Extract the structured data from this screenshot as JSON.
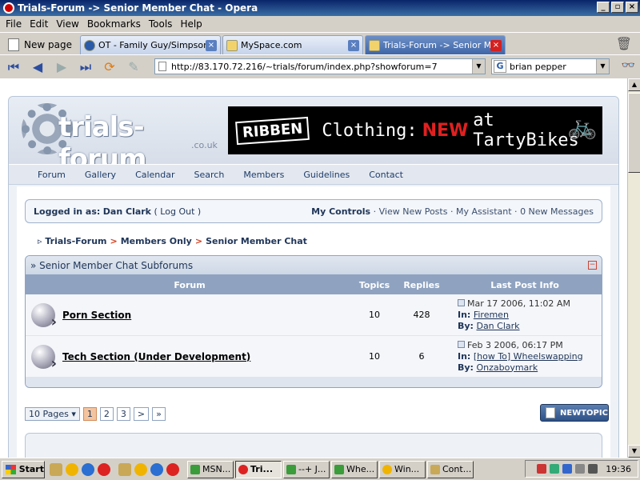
{
  "window": {
    "title": "Trials-Forum -> Senior Member Chat - Opera"
  },
  "menu": [
    "File",
    "Edit",
    "View",
    "Bookmarks",
    "Tools",
    "Help"
  ],
  "tabs": {
    "new_page": "New page",
    "items": [
      {
        "label": "OT - Family Guy/Simpson..."
      },
      {
        "label": "MySpace.com"
      },
      {
        "label": "Trials-Forum -> Senior Me..."
      }
    ]
  },
  "address": {
    "url": "http://83.170.72.216/~trials/forum/index.php?showforum=7"
  },
  "search": {
    "engine_glyph": "G",
    "value": "brian pepper"
  },
  "site": {
    "logo_name": "trials-forum",
    "logo_tld": ".co.uk",
    "ad": {
      "brand": "RIBBEN",
      "text1": "Clothing:",
      "new": "NEW",
      "text2": "at TartyBikes"
    },
    "nav": [
      "Forum",
      "Gallery",
      "Calendar",
      "Search",
      "Members",
      "Guidelines",
      "Contact"
    ]
  },
  "userbar": {
    "logged_in_label": "Logged in as:",
    "user": "Dan Clark",
    "logout": "( Log Out )",
    "my_controls": "My Controls",
    "links": [
      "View New Posts",
      "My Assistant",
      "0 New Messages"
    ]
  },
  "breadcrumb": [
    "Trials-Forum",
    "Members Only",
    "Senior Member Chat"
  ],
  "subforums": {
    "title": "Senior Member Chat Subforums",
    "columns": {
      "forum": "Forum",
      "topics": "Topics",
      "replies": "Replies",
      "last": "Last Post Info"
    },
    "in_label": "In:",
    "by_label": "By:",
    "rows": [
      {
        "name": "Porn Section",
        "topics": "10",
        "replies": "428",
        "date": "Mar 17 2006, 11:02 AM",
        "in": "Firemen",
        "by": "Dan Clark"
      },
      {
        "name": "Tech Section (Under Development)",
        "topics": "10",
        "replies": "6",
        "date": "Feb 3 2006, 06:17 PM",
        "in": "[how To] Wheelswapping",
        "by": "Onzaboymark"
      }
    ]
  },
  "pager": {
    "label": "10 Pages",
    "pages": [
      "1",
      "2",
      "3",
      ">",
      "»"
    ],
    "current": "1"
  },
  "new_topic": "NEWTOPIC",
  "taskbar": {
    "start": "Start",
    "buttons": [
      "MSN...",
      "Tri...",
      "--+ J...",
      "Whe...",
      "Win...",
      "Cont..."
    ],
    "active": "Tri...",
    "clock": "19:36"
  }
}
